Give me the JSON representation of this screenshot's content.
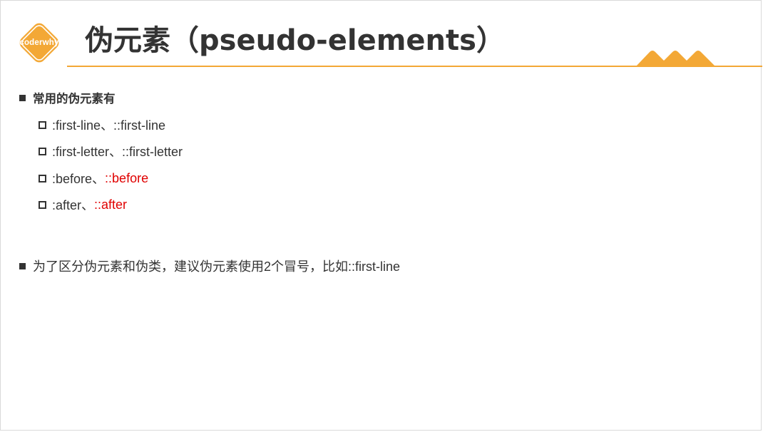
{
  "logo": {
    "text": "coderwhy"
  },
  "title": "伪元素（pseudo-elements）",
  "colors": {
    "accent": "#f3a836",
    "highlight": "#e00000",
    "text": "#333333"
  },
  "bullets": [
    {
      "text": "常用的伪元素有",
      "items": [
        {
          "plain": ":first-line、::first-line",
          "highlight": ""
        },
        {
          "plain": ":first-letter、::first-letter",
          "highlight": ""
        },
        {
          "plain": ":before、",
          "highlight": "::before"
        },
        {
          "plain": ":after、",
          "highlight": "::after"
        }
      ]
    },
    {
      "text": "为了区分伪元素和伪类，建议伪元素使用2个冒号，比如::first-line"
    }
  ]
}
